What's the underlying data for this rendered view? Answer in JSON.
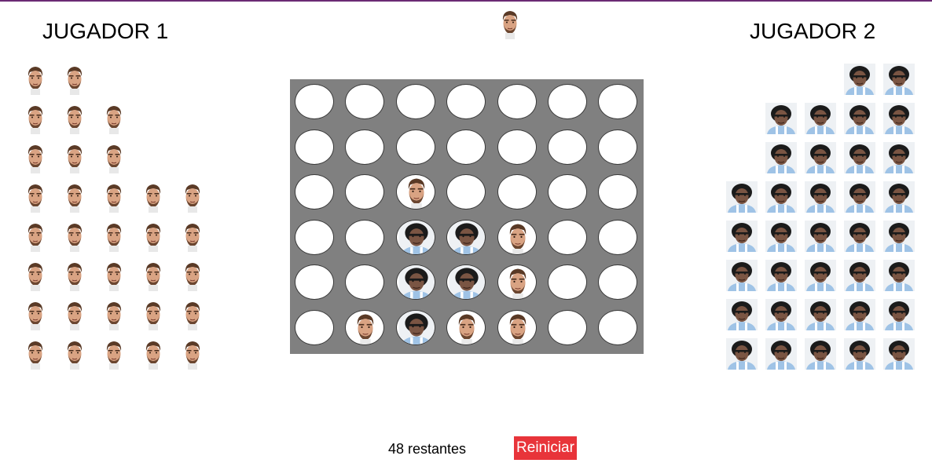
{
  "players": {
    "p1": {
      "title": "JUGADOR 1",
      "piece": "messi-face-icon",
      "rows": [
        2,
        3,
        3,
        5,
        5,
        5,
        5,
        5
      ]
    },
    "p2": {
      "title": "JUGADOR 2",
      "piece": "maradona-face-icon",
      "rows": [
        2,
        4,
        4,
        5,
        5,
        5,
        5,
        5
      ]
    }
  },
  "current_turn": "p1",
  "board": {
    "columns": 7,
    "rows": 6,
    "cells": [
      [
        0,
        0,
        0,
        0,
        0,
        0,
        0
      ],
      [
        0,
        0,
        0,
        0,
        0,
        0,
        0
      ],
      [
        0,
        0,
        1,
        0,
        0,
        0,
        0
      ],
      [
        0,
        0,
        2,
        2,
        1,
        0,
        0
      ],
      [
        0,
        0,
        2,
        2,
        1,
        0,
        0
      ],
      [
        0,
        1,
        2,
        1,
        1,
        0,
        0
      ]
    ]
  },
  "status": {
    "remaining_text": "48 restantes"
  },
  "controls": {
    "reset_label": "Reiniciar"
  },
  "colors": {
    "board": "#808080",
    "reset_button": "#e8343a",
    "top_line": "#6b2a74"
  }
}
